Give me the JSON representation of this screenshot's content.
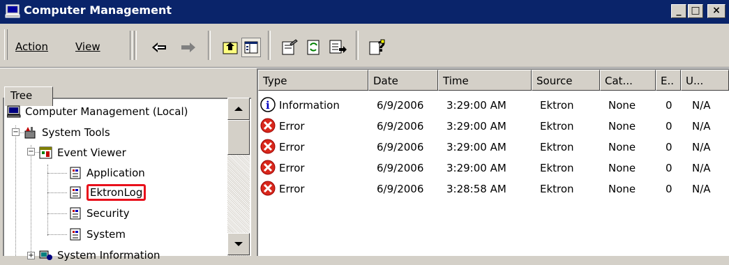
{
  "window": {
    "title": "Computer Management"
  },
  "title_buttons": {
    "minimize": "_",
    "maximize": "□",
    "close": "×"
  },
  "menu": [
    {
      "label": "Action"
    },
    {
      "label": "View"
    }
  ],
  "toolbar_icons": [
    "back-icon",
    "forward-icon",
    "up-folder-icon",
    "show-hide-tree-icon",
    "properties-icon",
    "refresh-icon",
    "export-list-icon",
    "help-icon"
  ],
  "tree": {
    "tab_label": "Tree",
    "items": [
      {
        "label": "Computer Management (Local)",
        "icon": "computer-icon",
        "level": 0
      },
      {
        "label": "System Tools",
        "icon": "tools-icon",
        "level": 1,
        "expander": "−"
      },
      {
        "label": "Event Viewer",
        "icon": "event-viewer-icon",
        "level": 2,
        "expander": "−"
      },
      {
        "label": "Application",
        "icon": "log-icon",
        "level": 3
      },
      {
        "label": "EktronLog",
        "icon": "log-icon",
        "level": 3,
        "selected": true
      },
      {
        "label": "Security",
        "icon": "log-icon",
        "level": 3
      },
      {
        "label": "System",
        "icon": "log-icon",
        "level": 3
      },
      {
        "label": "System Information",
        "icon": "system-info-icon",
        "level": 2,
        "expander": "+"
      }
    ]
  },
  "list": {
    "columns": [
      "Type",
      "Date",
      "Time",
      "Source",
      "Cat...",
      "E..",
      "U..."
    ],
    "rows": [
      {
        "type": "Information",
        "icon": "info-icon",
        "date": "6/9/2006",
        "time": "3:29:00 AM",
        "source": "Ektron",
        "category": "None",
        "event": "0",
        "user": "N/A"
      },
      {
        "type": "Error",
        "icon": "error-icon",
        "date": "6/9/2006",
        "time": "3:29:00 AM",
        "source": "Ektron",
        "category": "None",
        "event": "0",
        "user": "N/A"
      },
      {
        "type": "Error",
        "icon": "error-icon",
        "date": "6/9/2006",
        "time": "3:29:00 AM",
        "source": "Ektron",
        "category": "None",
        "event": "0",
        "user": "N/A"
      },
      {
        "type": "Error",
        "icon": "error-icon",
        "date": "6/9/2006",
        "time": "3:29:00 AM",
        "source": "Ektron",
        "category": "None",
        "event": "0",
        "user": "N/A"
      },
      {
        "type": "Error",
        "icon": "error-icon",
        "date": "6/9/2006",
        "time": "3:28:58 AM",
        "source": "Ektron",
        "category": "None",
        "event": "0",
        "user": "N/A"
      }
    ]
  },
  "colors": {
    "titlebar": "#0a246a",
    "highlight": "#e8101b",
    "error": "#d8281c",
    "face": "#d4d0c8"
  }
}
